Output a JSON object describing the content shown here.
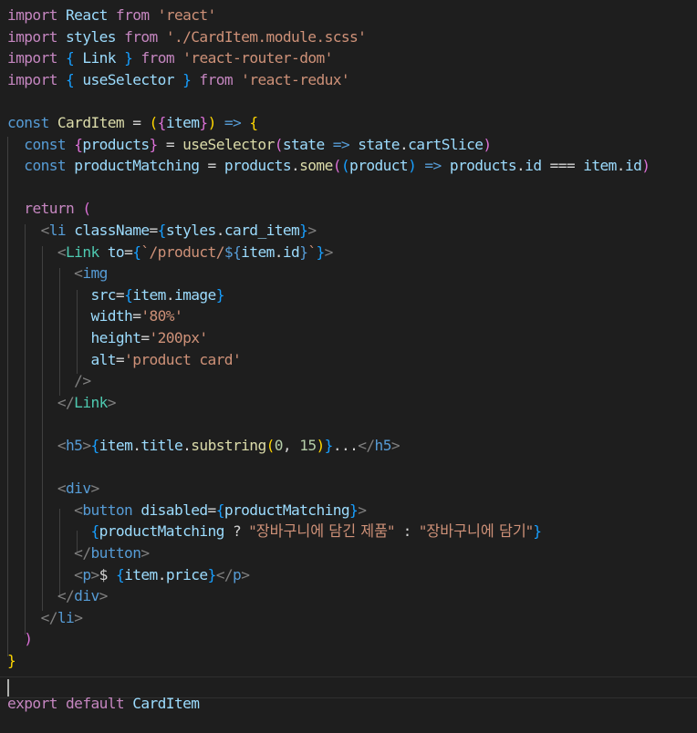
{
  "editor": {
    "language": "javascript-react",
    "theme_colors": {
      "background": "#1e1e1e",
      "keyword": "#c586c0",
      "string": "#ce9178",
      "variable": "#9cdcfe",
      "function": "#dcdcaa",
      "component": "#4ec9b0",
      "tag": "#569cd6",
      "bracket_level1": "#ffd700",
      "bracket_level2": "#da70d6",
      "bracket_level3": "#179fff",
      "punctuation": "#808080"
    },
    "lines": [
      [
        [
          "kw",
          "import"
        ],
        [
          "def",
          " "
        ],
        [
          "var",
          "React"
        ],
        [
          "def",
          " "
        ],
        [
          "kw",
          "from"
        ],
        [
          "def",
          " "
        ],
        [
          "st",
          "'react'"
        ]
      ],
      [
        [
          "kw",
          "import"
        ],
        [
          "def",
          " "
        ],
        [
          "var",
          "styles"
        ],
        [
          "def",
          " "
        ],
        [
          "kw",
          "from"
        ],
        [
          "def",
          " "
        ],
        [
          "st",
          "'./CardItem.module.scss'"
        ]
      ],
      [
        [
          "kw",
          "import"
        ],
        [
          "def",
          " "
        ],
        [
          "br3",
          "{"
        ],
        [
          "def",
          " "
        ],
        [
          "var",
          "Link"
        ],
        [
          "def",
          " "
        ],
        [
          "br3",
          "}"
        ],
        [
          "def",
          " "
        ],
        [
          "kw",
          "from"
        ],
        [
          "def",
          " "
        ],
        [
          "st",
          "'react-router-dom'"
        ]
      ],
      [
        [
          "kw",
          "import"
        ],
        [
          "def",
          " "
        ],
        [
          "br3",
          "{"
        ],
        [
          "def",
          " "
        ],
        [
          "var",
          "useSelector"
        ],
        [
          "def",
          " "
        ],
        [
          "br3",
          "}"
        ],
        [
          "def",
          " "
        ],
        [
          "kw",
          "from"
        ],
        [
          "def",
          " "
        ],
        [
          "st",
          "'react-redux'"
        ]
      ],
      [],
      [
        [
          "const",
          "const"
        ],
        [
          "def",
          " "
        ],
        [
          "fn",
          "CardItem"
        ],
        [
          "def",
          " = "
        ],
        [
          "br1",
          "("
        ],
        [
          "br2",
          "{"
        ],
        [
          "var",
          "item"
        ],
        [
          "br2",
          "}"
        ],
        [
          "br1",
          ")"
        ],
        [
          "def",
          " "
        ],
        [
          "const",
          "=>"
        ],
        [
          "def",
          " "
        ],
        [
          "br1",
          "{"
        ]
      ],
      [
        [
          "def",
          "  "
        ],
        [
          "const",
          "const"
        ],
        [
          "def",
          " "
        ],
        [
          "br2",
          "{"
        ],
        [
          "var",
          "products"
        ],
        [
          "br2",
          "}"
        ],
        [
          "def",
          " = "
        ],
        [
          "fn",
          "useSelector"
        ],
        [
          "br2",
          "("
        ],
        [
          "var",
          "state"
        ],
        [
          "def",
          " "
        ],
        [
          "const",
          "=>"
        ],
        [
          "def",
          " "
        ],
        [
          "var",
          "state"
        ],
        [
          "def",
          "."
        ],
        [
          "var",
          "cartSlice"
        ],
        [
          "br2",
          ")"
        ]
      ],
      [
        [
          "def",
          "  "
        ],
        [
          "const",
          "const"
        ],
        [
          "def",
          " "
        ],
        [
          "var",
          "productMatching"
        ],
        [
          "def",
          " = "
        ],
        [
          "var",
          "products"
        ],
        [
          "def",
          "."
        ],
        [
          "fn",
          "some"
        ],
        [
          "br2",
          "("
        ],
        [
          "br3",
          "("
        ],
        [
          "var",
          "product"
        ],
        [
          "br3",
          ")"
        ],
        [
          "def",
          " "
        ],
        [
          "const",
          "=>"
        ],
        [
          "def",
          " "
        ],
        [
          "var",
          "products"
        ],
        [
          "def",
          "."
        ],
        [
          "var",
          "id"
        ],
        [
          "def",
          " === "
        ],
        [
          "var",
          "item"
        ],
        [
          "def",
          "."
        ],
        [
          "var",
          "id"
        ],
        [
          "br2",
          ")"
        ]
      ],
      [],
      [
        [
          "def",
          "  "
        ],
        [
          "kw",
          "return"
        ],
        [
          "def",
          " "
        ],
        [
          "br2",
          "("
        ]
      ],
      [
        [
          "def",
          "    "
        ],
        [
          "gray",
          "<"
        ],
        [
          "tag",
          "li"
        ],
        [
          "def",
          " "
        ],
        [
          "var",
          "className"
        ],
        [
          "def",
          "="
        ],
        [
          "br3",
          "{"
        ],
        [
          "var",
          "styles"
        ],
        [
          "def",
          "."
        ],
        [
          "var",
          "card_item"
        ],
        [
          "br3",
          "}"
        ],
        [
          "gray",
          ">"
        ]
      ],
      [
        [
          "def",
          "      "
        ],
        [
          "gray",
          "<"
        ],
        [
          "comp",
          "Link"
        ],
        [
          "def",
          " "
        ],
        [
          "var",
          "to"
        ],
        [
          "def",
          "="
        ],
        [
          "br3",
          "{"
        ],
        [
          "st",
          "`/product/"
        ],
        [
          "const",
          "${"
        ],
        [
          "var",
          "item"
        ],
        [
          "def",
          "."
        ],
        [
          "var",
          "id"
        ],
        [
          "const",
          "}"
        ],
        [
          "st",
          "`"
        ],
        [
          "br3",
          "}"
        ],
        [
          "gray",
          ">"
        ]
      ],
      [
        [
          "def",
          "        "
        ],
        [
          "gray",
          "<"
        ],
        [
          "tag",
          "img"
        ]
      ],
      [
        [
          "def",
          "          "
        ],
        [
          "var",
          "src"
        ],
        [
          "def",
          "="
        ],
        [
          "br3",
          "{"
        ],
        [
          "var",
          "item"
        ],
        [
          "def",
          "."
        ],
        [
          "var",
          "image"
        ],
        [
          "br3",
          "}"
        ]
      ],
      [
        [
          "def",
          "          "
        ],
        [
          "var",
          "width"
        ],
        [
          "def",
          "="
        ],
        [
          "st",
          "'80%'"
        ]
      ],
      [
        [
          "def",
          "          "
        ],
        [
          "var",
          "height"
        ],
        [
          "def",
          "="
        ],
        [
          "st",
          "'200px'"
        ]
      ],
      [
        [
          "def",
          "          "
        ],
        [
          "var",
          "alt"
        ],
        [
          "def",
          "="
        ],
        [
          "st",
          "'product card'"
        ]
      ],
      [
        [
          "def",
          "        "
        ],
        [
          "gray",
          "/>"
        ]
      ],
      [
        [
          "def",
          "      "
        ],
        [
          "gray",
          "</"
        ],
        [
          "comp",
          "Link"
        ],
        [
          "gray",
          ">"
        ]
      ],
      [],
      [
        [
          "def",
          "      "
        ],
        [
          "gray",
          "<"
        ],
        [
          "tag",
          "h5"
        ],
        [
          "gray",
          ">"
        ],
        [
          "br3",
          "{"
        ],
        [
          "var",
          "item"
        ],
        [
          "def",
          "."
        ],
        [
          "var",
          "title"
        ],
        [
          "def",
          "."
        ],
        [
          "fn",
          "substring"
        ],
        [
          "br1",
          "("
        ],
        [
          "num",
          "0"
        ],
        [
          "def",
          ", "
        ],
        [
          "num",
          "15"
        ],
        [
          "br1",
          ")"
        ],
        [
          "br3",
          "}"
        ],
        [
          "def",
          "..."
        ],
        [
          "gray",
          "</"
        ],
        [
          "tag",
          "h5"
        ],
        [
          "gray",
          ">"
        ]
      ],
      [],
      [
        [
          "def",
          "      "
        ],
        [
          "gray",
          "<"
        ],
        [
          "tag",
          "div"
        ],
        [
          "gray",
          ">"
        ]
      ],
      [
        [
          "def",
          "        "
        ],
        [
          "gray",
          "<"
        ],
        [
          "tag",
          "button"
        ],
        [
          "def",
          " "
        ],
        [
          "var",
          "disabled"
        ],
        [
          "def",
          "="
        ],
        [
          "br3",
          "{"
        ],
        [
          "var",
          "productMatching"
        ],
        [
          "br3",
          "}"
        ],
        [
          "gray",
          ">"
        ]
      ],
      [
        [
          "def",
          "          "
        ],
        [
          "br3",
          "{"
        ],
        [
          "var",
          "productMatching"
        ],
        [
          "def",
          " ? "
        ],
        [
          "st",
          "\"장바구니에 담긴 제품\""
        ],
        [
          "def",
          " : "
        ],
        [
          "st",
          "\"장바구니에 담기\""
        ],
        [
          "br3",
          "}"
        ]
      ],
      [
        [
          "def",
          "        "
        ],
        [
          "gray",
          "</"
        ],
        [
          "tag",
          "button"
        ],
        [
          "gray",
          ">"
        ]
      ],
      [
        [
          "def",
          "        "
        ],
        [
          "gray",
          "<"
        ],
        [
          "tag",
          "p"
        ],
        [
          "gray",
          ">"
        ],
        [
          "def",
          "$ "
        ],
        [
          "br3",
          "{"
        ],
        [
          "var",
          "item"
        ],
        [
          "def",
          "."
        ],
        [
          "var",
          "price"
        ],
        [
          "br3",
          "}"
        ],
        [
          "gray",
          "</"
        ],
        [
          "tag",
          "p"
        ],
        [
          "gray",
          ">"
        ]
      ],
      [
        [
          "def",
          "      "
        ],
        [
          "gray",
          "</"
        ],
        [
          "tag",
          "div"
        ],
        [
          "gray",
          ">"
        ]
      ],
      [
        [
          "def",
          "    "
        ],
        [
          "gray",
          "</"
        ],
        [
          "tag",
          "li"
        ],
        [
          "gray",
          ">"
        ]
      ],
      [
        [
          "def",
          "  "
        ],
        [
          "br2",
          ")"
        ]
      ],
      [
        [
          "br1",
          "}"
        ]
      ],
      [],
      [
        [
          "kw",
          "export"
        ],
        [
          "def",
          " "
        ],
        [
          "kw",
          "default"
        ],
        [
          "def",
          " "
        ],
        [
          "var",
          "CardItem"
        ]
      ]
    ]
  }
}
